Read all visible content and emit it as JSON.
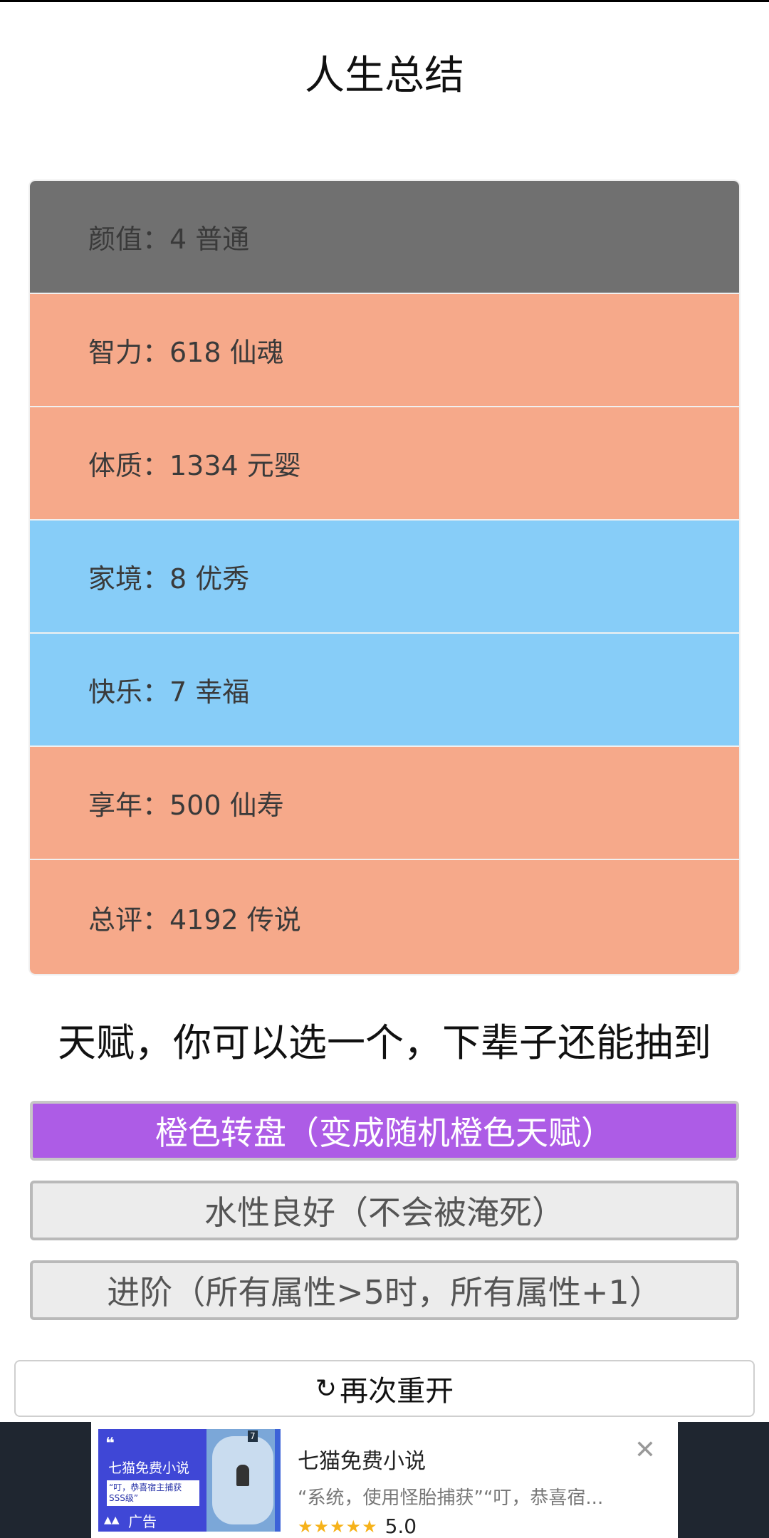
{
  "header": {
    "title": "人生总结"
  },
  "stats": [
    {
      "text": "颜值：4 普通",
      "color": "#707070"
    },
    {
      "text": "智力：618 仙魂",
      "color": "#f6a98a"
    },
    {
      "text": "体质：1334 元婴",
      "color": "#f6a98a"
    },
    {
      "text": "家境：8 优秀",
      "color": "#87cdf8"
    },
    {
      "text": "快乐：7 幸福",
      "color": "#87cdf8"
    },
    {
      "text": "享年：500 仙寿",
      "color": "#f6a98a"
    },
    {
      "text": "总评：4192 传说",
      "color": "#f6a98a"
    }
  ],
  "talents": {
    "heading": "天赋，你可以选一个，下辈子还能抽到",
    "options": [
      {
        "label": "橙色转盘（变成随机橙色天赋）",
        "selected": true
      },
      {
        "label": "水性良好（不会被淹死）",
        "selected": false
      },
      {
        "label": "进阶（所有属性>5时，所有属性+1）",
        "selected": false
      }
    ]
  },
  "restart": {
    "icon": "refresh-icon",
    "label": "再次重开"
  },
  "ad": {
    "thumb_quote": "❝",
    "thumb_title": "七猫免费小说",
    "thumb_text": "“叮，恭喜宿主捕获SSS级”",
    "thumb_label": "广告",
    "image_tag": "7",
    "title": "七猫免费小说",
    "description": "“系统，使用怪胎捕获”“叮，恭喜宿...",
    "stars": "★★★★★",
    "rating": "5.0",
    "close_icon": "close-icon"
  }
}
